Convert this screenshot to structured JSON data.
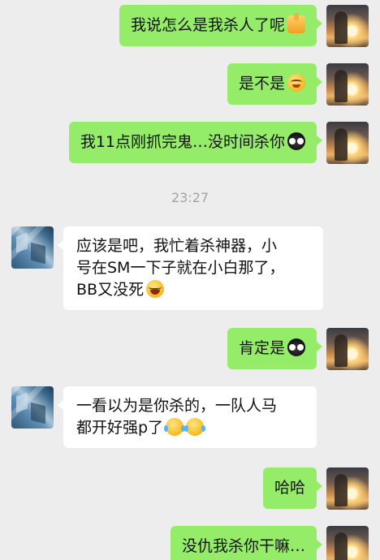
{
  "messages": [
    {
      "side": "self",
      "text": "我说怎么是我杀人了呢",
      "emoji": "thumbs-up-icon"
    },
    {
      "side": "self",
      "text": "是不是",
      "emoji": "squint-grin-icon"
    },
    {
      "side": "self",
      "text": "我11点刚抓完鬼…没时间杀你",
      "emoji": "owl-icon"
    },
    {
      "side": "other",
      "line1": "应该是吧，我忙着杀神器，小",
      "line2": "号在SM一下子就在小白那了，",
      "line3": "BB又没死",
      "emoji": "laughing-icon"
    },
    {
      "side": "self",
      "text": "肯定是",
      "emoji": "owl-icon"
    },
    {
      "side": "other",
      "line1": "一看以为是你杀的，一队人马",
      "line2": "都开好强p了",
      "emoji": "crying-laughing-icon"
    },
    {
      "side": "self",
      "text": "哈哈"
    },
    {
      "side": "self",
      "text": "没仇我杀你干嘛…"
    }
  ],
  "timestamp": "23:27",
  "colors": {
    "background": "#ededed",
    "self_bubble": "#95ec69",
    "other_bubble": "#ffffff"
  }
}
